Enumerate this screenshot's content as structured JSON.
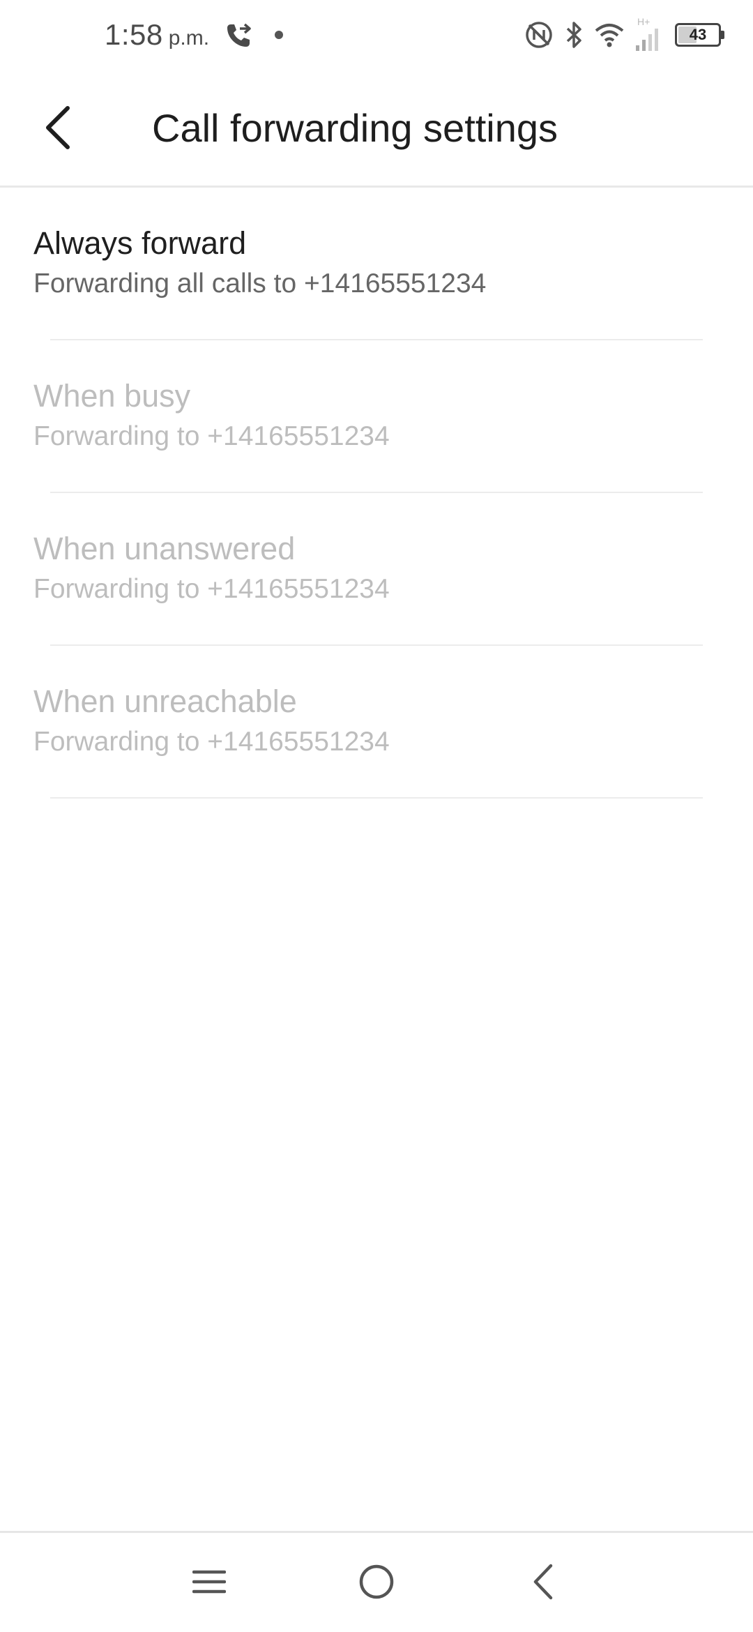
{
  "status_bar": {
    "time": "1:58",
    "ampm": "p.m.",
    "battery_level": "43",
    "network_type": "H+",
    "icons": [
      "call-forwarding-icon",
      "notification-dot-icon",
      "nfc-icon",
      "bluetooth-icon",
      "wifi-icon",
      "cellular-signal-icon",
      "battery-icon"
    ]
  },
  "app_bar": {
    "title": "Call forwarding settings",
    "back_icon": "back-arrow-icon"
  },
  "settings": [
    {
      "title": "Always forward",
      "subtitle": "Forwarding all calls to +14165551234",
      "enabled": true
    },
    {
      "title": "When busy",
      "subtitle": "Forwarding to +14165551234",
      "enabled": false
    },
    {
      "title": "When unanswered",
      "subtitle": "Forwarding to +14165551234",
      "enabled": false
    },
    {
      "title": "When unreachable",
      "subtitle": "Forwarding to +14165551234",
      "enabled": false
    }
  ],
  "nav_bar": {
    "icons": [
      "menu-icon",
      "home-icon",
      "back-icon"
    ]
  },
  "colors": {
    "title_text": "#1e1e1e",
    "enabled_subtitle": "#666666",
    "disabled_text": "#bdbdbd",
    "divider": "#ececec"
  }
}
